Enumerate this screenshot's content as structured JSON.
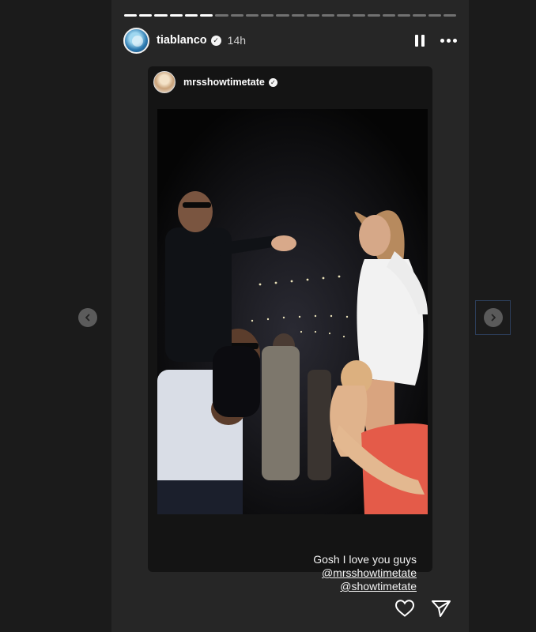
{
  "story": {
    "progress": {
      "total_segments": 22,
      "completed_segments": 6
    },
    "header": {
      "username": "tiablanco",
      "time": "14h",
      "verified_glyph": "✓",
      "icons": [
        "pause-icon",
        "more-options-icon"
      ]
    },
    "reshared_post": {
      "username": "mrsshowtimetate",
      "verified_glyph": "✓"
    },
    "caption": {
      "text": "Gosh I love you guys",
      "mentions": [
        "@mrsshowtimetate",
        "@showtimetate"
      ]
    },
    "footer_icons": [
      "heart-icon",
      "send-icon"
    ]
  },
  "navigation": {
    "prev_icon": "chevron-left-icon",
    "next_icon": "chevron-right-icon"
  },
  "colors": {
    "page_background": "#1b1b1b",
    "story_background": "#262626",
    "card_background": "#141414"
  }
}
